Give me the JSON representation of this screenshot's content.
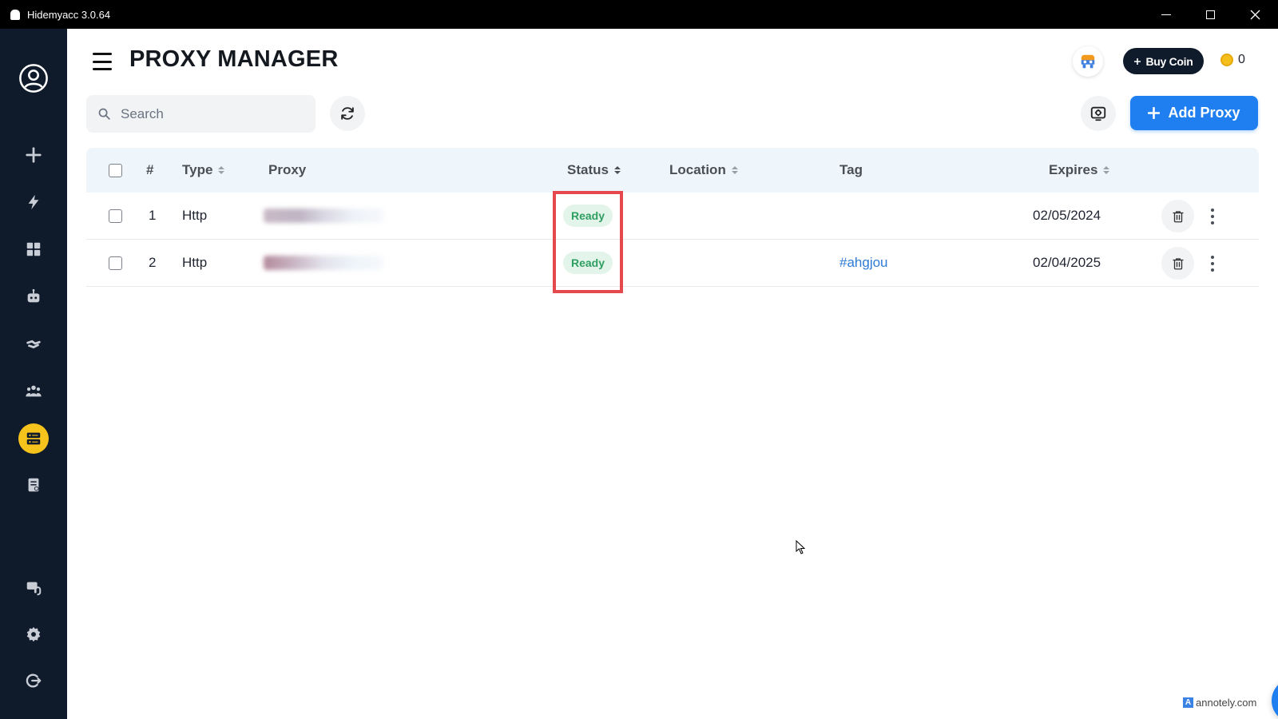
{
  "window": {
    "title": "Hidemyacc 3.0.64"
  },
  "sidebar": {
    "items": [
      {
        "icon": "user-circle-icon"
      },
      {
        "icon": "plus-icon"
      },
      {
        "icon": "lightning-icon"
      },
      {
        "icon": "grid-icon"
      },
      {
        "icon": "robot-icon"
      },
      {
        "icon": "link-icon"
      },
      {
        "icon": "team-icon"
      },
      {
        "icon": "proxy-server-icon",
        "active": true
      },
      {
        "icon": "document-icon"
      },
      {
        "icon": "support-icon"
      },
      {
        "icon": "gear-icon"
      },
      {
        "icon": "logout-icon"
      }
    ]
  },
  "header": {
    "title": "PROXY MANAGER",
    "buy_coin_label": "Buy Coin",
    "coin_balance": "0"
  },
  "toolbar": {
    "search_placeholder": "Search",
    "add_proxy_label": "Add Proxy"
  },
  "table": {
    "columns": {
      "index": "#",
      "type": "Type",
      "proxy": "Proxy",
      "status": "Status",
      "location": "Location",
      "tag": "Tag",
      "expires": "Expires"
    },
    "rows": [
      {
        "index": "1",
        "type": "Http",
        "status": "Ready",
        "location": "",
        "tag": "",
        "expires": "02/05/2024"
      },
      {
        "index": "2",
        "type": "Http",
        "status": "Ready",
        "location": "",
        "tag": "#ahgjou",
        "expires": "02/04/2025"
      }
    ]
  },
  "watermark": {
    "text": "annotely.com"
  },
  "colors": {
    "sidebar_bg": "#0f1a2b",
    "accent_blue": "#1f7ef0",
    "active_yellow": "#f6c21c",
    "status_green": "#2f9e61",
    "highlight_red": "#e5484d"
  }
}
